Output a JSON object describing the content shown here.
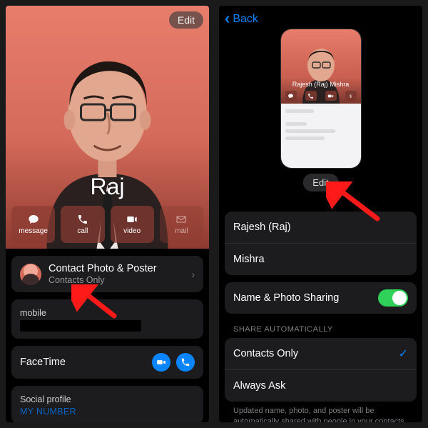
{
  "left": {
    "edit_label": "Edit",
    "name": "Raj",
    "buttons": {
      "message": "message",
      "call": "call",
      "video": "video",
      "mail": "mail"
    },
    "photo_poster": {
      "title": "Contact Photo & Poster",
      "subtitle": "Contacts Only"
    },
    "mobile_label": "mobile",
    "facetime_label": "FaceTime",
    "social_label": "Social profile",
    "my_number_label": "MY NUMBER"
  },
  "right": {
    "back_label": "Back",
    "preview_name": "Rajesh (Raj) Mishra",
    "edit_label": "Edit",
    "first_name": "Rajesh (Raj)",
    "last_name": "Mishra",
    "share_toggle_label": "Name & Photo Sharing",
    "share_section_header": "Share Automatically",
    "option_contacts": "Contacts Only",
    "option_ask": "Always Ask",
    "footer": "Updated name, photo, and poster will be automatically shared with people in your contacts."
  }
}
